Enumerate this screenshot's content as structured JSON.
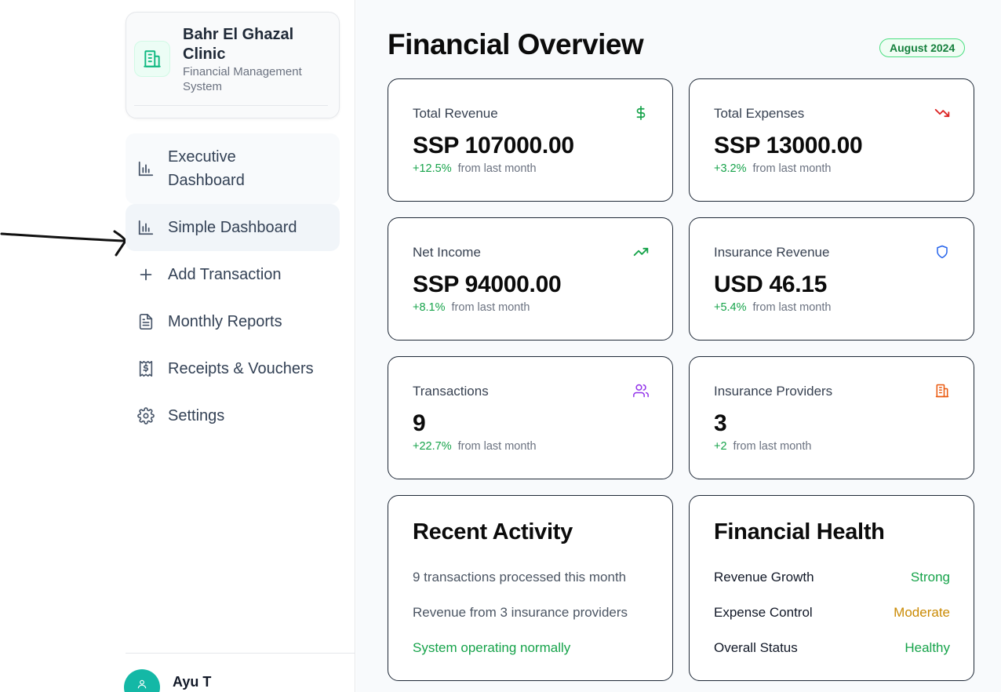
{
  "brand": {
    "name": "Bahr El Ghazal Clinic",
    "subtitle": "Financial Management System",
    "accent": "#10b981"
  },
  "nav": {
    "items": [
      {
        "label": "Executive Dashboard",
        "icon": "bar-chart-icon"
      },
      {
        "label": "Simple Dashboard",
        "icon": "bar-chart-icon",
        "active": true
      },
      {
        "label": "Add Transaction",
        "icon": "plus-icon"
      },
      {
        "label": "Monthly Reports",
        "icon": "file-text-icon"
      },
      {
        "label": "Receipts & Vouchers",
        "icon": "receipt-icon"
      },
      {
        "label": "Settings",
        "icon": "gear-icon"
      }
    ]
  },
  "user": {
    "name": "Ayu T",
    "avatar_color": "#14b8a6"
  },
  "header": {
    "title": "Financial Overview",
    "period": "August 2024"
  },
  "stats": [
    {
      "label": "Total Revenue",
      "value": "SSP 107000.00",
      "change": "+12.5%",
      "suffix": "from last month",
      "icon": "dollar-icon",
      "icon_color": "#16a34a"
    },
    {
      "label": "Total Expenses",
      "value": "SSP 13000.00",
      "change": "+3.2%",
      "suffix": "from last month",
      "icon": "trending-down-icon",
      "icon_color": "#dc2626"
    },
    {
      "label": "Net Income",
      "value": "SSP 94000.00",
      "change": "+8.1%",
      "suffix": "from last month",
      "icon": "trending-up-icon",
      "icon_color": "#16a34a"
    },
    {
      "label": "Insurance Revenue",
      "value": "USD 46.15",
      "change": "+5.4%",
      "suffix": "from last month",
      "icon": "shield-icon",
      "icon_color": "#2563eb"
    },
    {
      "label": "Transactions",
      "value": "9",
      "change": "+22.7%",
      "suffix": "from last month",
      "icon": "users-icon",
      "icon_color": "#9333ea"
    },
    {
      "label": "Insurance Providers",
      "value": "3",
      "change": "+2",
      "suffix": "from last month",
      "icon": "building-icon",
      "icon_color": "#ea580c"
    }
  ],
  "recent_activity": {
    "title": "Recent Activity",
    "lines": [
      "9 transactions processed this month",
      "Revenue from 3 insurance providers",
      "System operating normally"
    ]
  },
  "financial_health": {
    "title": "Financial Health",
    "rows": [
      {
        "label": "Revenue Growth",
        "status": "Strong",
        "color": "#16a34a"
      },
      {
        "label": "Expense Control",
        "status": "Moderate",
        "color": "#ca8a04"
      },
      {
        "label": "Overall Status",
        "status": "Healthy",
        "color": "#16a34a"
      }
    ]
  }
}
